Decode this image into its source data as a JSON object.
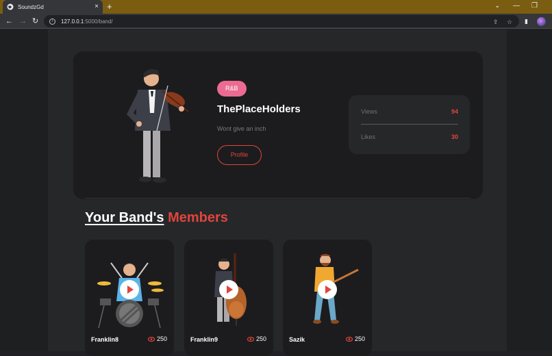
{
  "browser": {
    "tab_title": "SoundzGd",
    "tab_close": "×",
    "new_tab": "+",
    "url_host": "127.0.0.1",
    "url_path": ":5000/band/",
    "controls": {
      "minimize": "—",
      "restore": "❐",
      "dropdown": "⌄"
    },
    "nav": {
      "back": "←",
      "forward": "→",
      "reload": "↻"
    },
    "toolbar_icons": {
      "share": "⇪",
      "bookmark": "☆",
      "sidebar": "▮"
    }
  },
  "band": {
    "genre": "R&B",
    "name": "ThePlaceHolders",
    "tagline": "Wont give an inch",
    "profile_button": "Profile",
    "stats": [
      {
        "label": "Views",
        "value": "94"
      },
      {
        "label": "Likes",
        "value": "30"
      }
    ]
  },
  "members_section": {
    "heading_part1": "Your Band's",
    "heading_part2": "Members"
  },
  "members": [
    {
      "name": "Franklin8",
      "views": "250",
      "instrument_icon": "drummer"
    },
    {
      "name": "Franklin9",
      "views": "250",
      "instrument_icon": "double-bass-player"
    },
    {
      "name": "Sazik",
      "views": "250",
      "instrument_icon": "guitarist"
    }
  ],
  "colors": {
    "accent": "#e0453d",
    "genre_badge": "#ec6b92",
    "tab_strip": "#7a5d10"
  }
}
